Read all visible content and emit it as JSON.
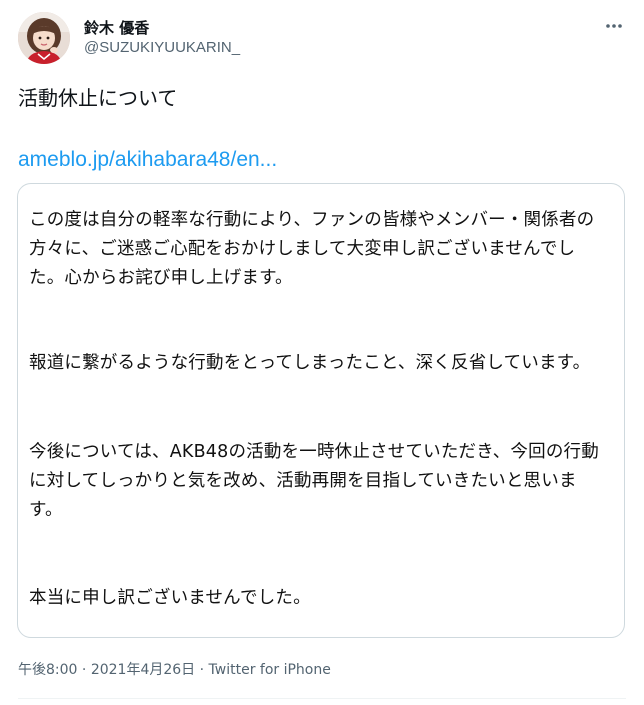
{
  "user": {
    "display_name": "鈴木 優香",
    "handle": "@SUZUKIYUUKARIN_"
  },
  "tweet": {
    "text": "活動休止について",
    "link_text": "ameblo.jp/akihabara48/en...",
    "card": {
      "paragraphs": [
        "この度は自分の軽率な行動により、ファンの皆様やメンバー・関係者の方々に、ご迷惑ご心配をおかけしまして大変申し訳ございませんでした。心からお詫び申し上げます。",
        "報道に繋がるような行動をとってしまったこと、深く反省しています。",
        "今後については、AKB48の活動を一時休止させていただき、今回の行動に対してしっかりと気を改め、活動再開を目指していきたいと思います。",
        "本当に申し訳ございませんでした。"
      ]
    }
  },
  "meta": {
    "time": "午後8:00",
    "separator": " · ",
    "date": "2021年4月26日",
    "source": "Twitter for iPhone"
  },
  "icons": {
    "more": "more-horizontal-icon",
    "avatar": "user-avatar"
  },
  "colors": {
    "link": "#1d9bf0",
    "secondary_text": "#536471",
    "border": "#cfd9de"
  }
}
